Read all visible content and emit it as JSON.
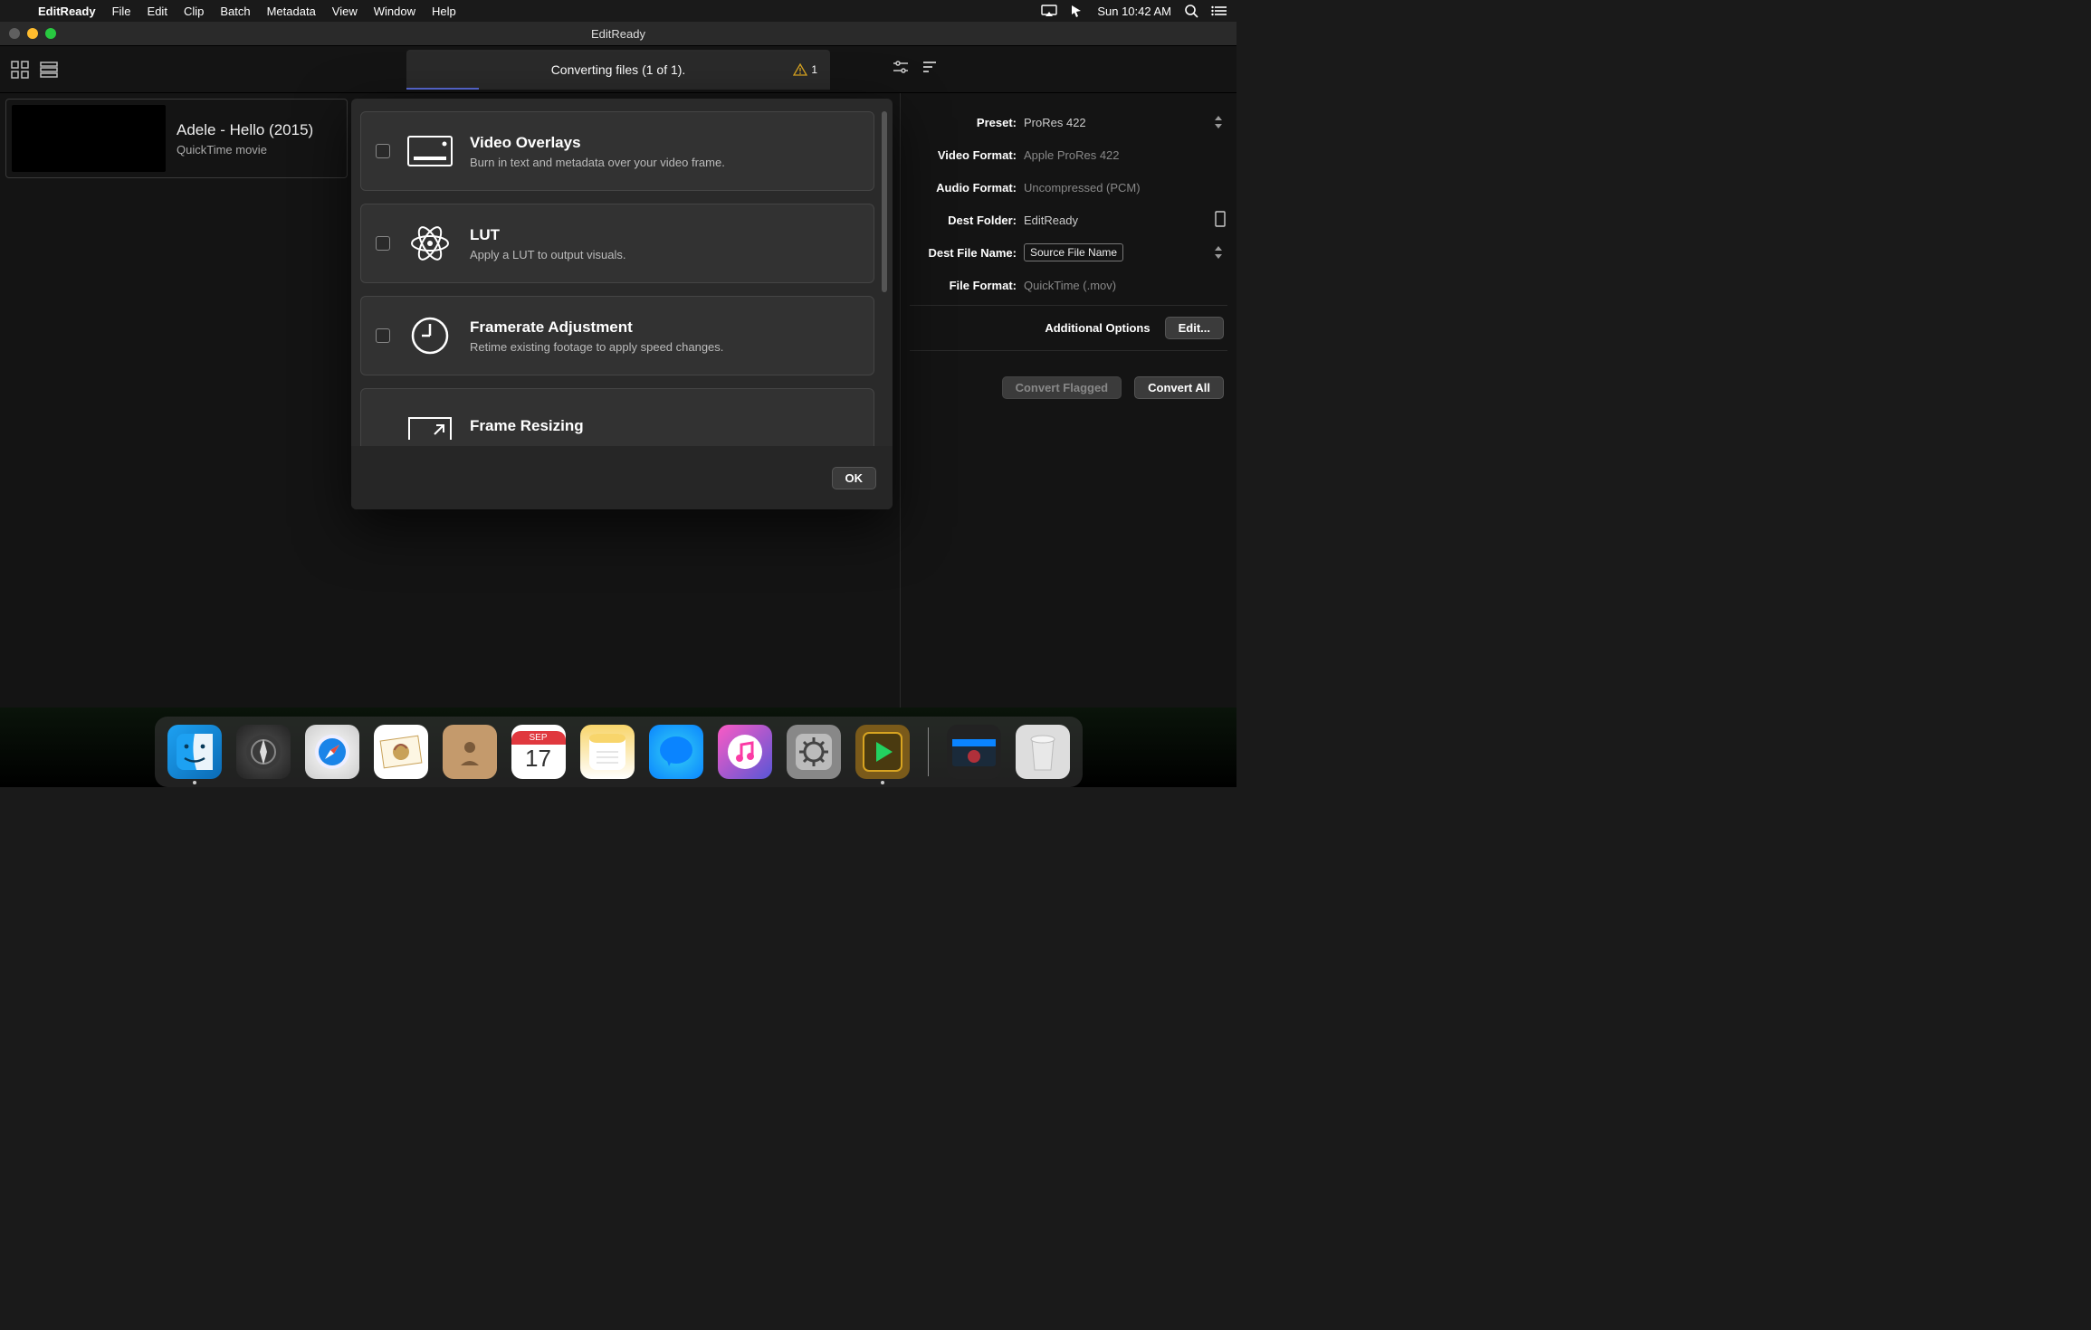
{
  "menubar": {
    "app_name": "EditReady",
    "items": [
      "File",
      "Edit",
      "Clip",
      "Batch",
      "Metadata",
      "View",
      "Window",
      "Help"
    ],
    "clock": "Sun 10:42 AM"
  },
  "window": {
    "title": "EditReady"
  },
  "progress": {
    "label": "Converting files (1 of 1).",
    "warning_count": "1"
  },
  "clip": {
    "title": "Adele - Hello (2015)",
    "subtitle": "QuickTime movie"
  },
  "modal": {
    "options": [
      {
        "title": "Video Overlays",
        "desc": "Burn in text and metadata over your video frame."
      },
      {
        "title": "LUT",
        "desc": "Apply a LUT to output visuals."
      },
      {
        "title": "Framerate Adjustment",
        "desc": "Retime existing footage to apply speed changes."
      },
      {
        "title": "Frame Resizing",
        "desc": ""
      }
    ],
    "ok_label": "OK"
  },
  "rightpanel": {
    "labels": {
      "preset": "Preset:",
      "video_format": "Video Format:",
      "audio_format": "Audio Format:",
      "dest_folder": "Dest Folder:",
      "dest_file_name": "Dest File Name:",
      "file_format": "File Format:",
      "additional": "Additional Options",
      "edit": "Edit...",
      "convert_flagged": "Convert Flagged",
      "convert_all": "Convert All"
    },
    "values": {
      "preset": "ProRes 422",
      "video_format": "Apple ProRes 422",
      "audio_format": "Uncompressed (PCM)",
      "dest_folder": "EditReady",
      "dest_file_name": "Source File Name",
      "file_format": "QuickTime (.mov)"
    }
  },
  "dock": {
    "cal_month": "SEP",
    "cal_day": "17"
  }
}
